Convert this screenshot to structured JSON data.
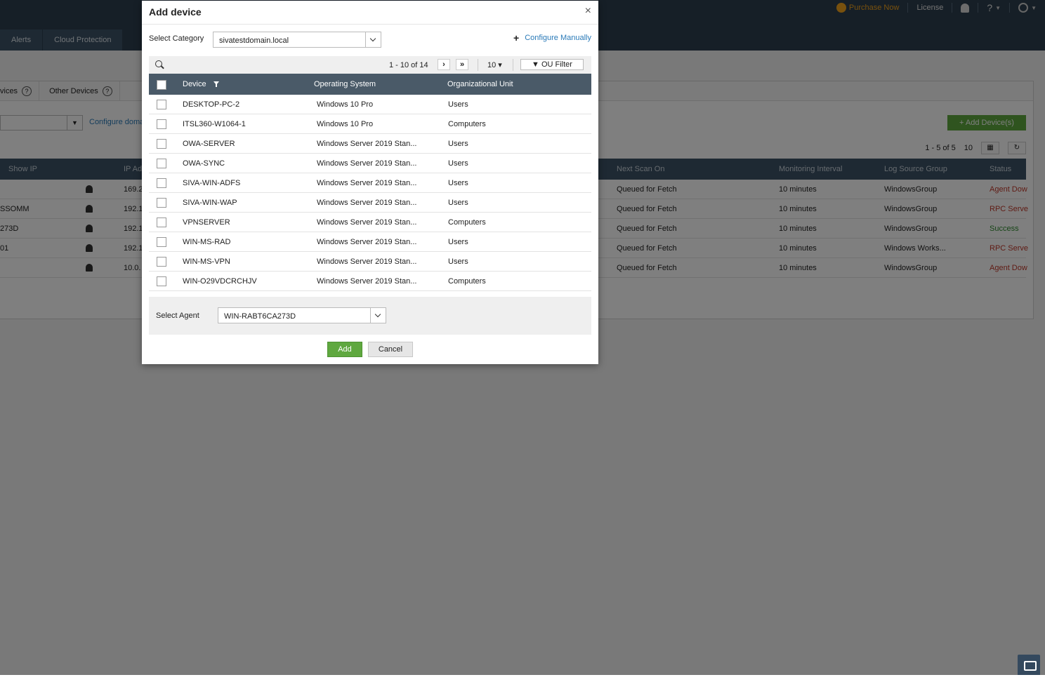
{
  "topbar": {
    "purchase": "Purchase Now",
    "license": "License"
  },
  "nav": {
    "tabs": [
      "Alerts",
      "Cloud Protection"
    ]
  },
  "subtabs": {
    "devices": "vices",
    "other_devices": "Other Devices"
  },
  "background": {
    "configure_domain": "Configure domai",
    "add_devices": "+ Add Device(s)",
    "pager": "1 - 5 of 5",
    "per_page": "10",
    "headers": {
      "show_ip": "Show IP",
      "ip_address": "IP Ad",
      "next_scan": "Next Scan On",
      "monitoring": "Monitoring Interval",
      "log_source": "Log Source Group",
      "status": "Status"
    },
    "rows": [
      {
        "name": "",
        "ip": "169.2",
        "next_scan": "Queued for Fetch",
        "interval": "10 minutes",
        "group": "WindowsGroup",
        "status": "Agent Dow"
      },
      {
        "name": "SSOMM",
        "ip": "192.1",
        "next_scan": "Queued for Fetch",
        "interval": "10 minutes",
        "group": "WindowsGroup",
        "status": "RPC Serve"
      },
      {
        "name": "273D",
        "ip": "192.1",
        "next_scan": "Queued for Fetch",
        "interval": "10 minutes",
        "group": "WindowsGroup",
        "status": "Success"
      },
      {
        "name": "01",
        "ip": "192.1",
        "next_scan": "Queued for Fetch",
        "interval": "10 minutes",
        "group": "Windows Works...",
        "status": "RPC Serve"
      },
      {
        "name": "",
        "ip": "10.0.",
        "next_scan": "Queued for Fetch",
        "interval": "10 minutes",
        "group": "WindowsGroup",
        "status": "Agent Dow"
      }
    ]
  },
  "modal": {
    "title": "Add device",
    "close": "×",
    "select_category_label": "Select Category",
    "select_category_value": "sivatestdomain.local",
    "configure_manually": "Configure Manually",
    "pager_text": "1 - 10 of 14",
    "next": "›",
    "last": "»",
    "per_page": "10 ▾",
    "ou_filter": "▼ OU Filter",
    "columns": {
      "device": "Device",
      "os": "Operating System",
      "ou": "Organizational Unit"
    },
    "rows": [
      {
        "device": "DESKTOP-PC-2",
        "os": "Windows 10 Pro",
        "ou": "Users"
      },
      {
        "device": "ITSL360-W1064-1",
        "os": "Windows 10 Pro",
        "ou": "Computers"
      },
      {
        "device": "OWA-SERVER",
        "os": "Windows Server 2019 Stan...",
        "ou": "Users"
      },
      {
        "device": "OWA-SYNC",
        "os": "Windows Server 2019 Stan...",
        "ou": "Users"
      },
      {
        "device": "SIVA-WIN-ADFS",
        "os": "Windows Server 2019 Stan...",
        "ou": "Users"
      },
      {
        "device": "SIVA-WIN-WAP",
        "os": "Windows Server 2019 Stan...",
        "ou": "Users"
      },
      {
        "device": "VPNSERVER",
        "os": "Windows Server 2019 Stan...",
        "ou": "Computers"
      },
      {
        "device": "WIN-MS-RAD",
        "os": "Windows Server 2019 Stan...",
        "ou": "Users"
      },
      {
        "device": "WIN-MS-VPN",
        "os": "Windows Server 2019 Stan...",
        "ou": "Users"
      },
      {
        "device": "WIN-O29VDCRCHJV",
        "os": "Windows Server 2019 Stan...",
        "ou": "Computers"
      }
    ],
    "select_agent_label": "Select Agent",
    "select_agent_value": "WIN-RABT6CA273D",
    "add_button": "Add",
    "cancel_button": "Cancel"
  }
}
